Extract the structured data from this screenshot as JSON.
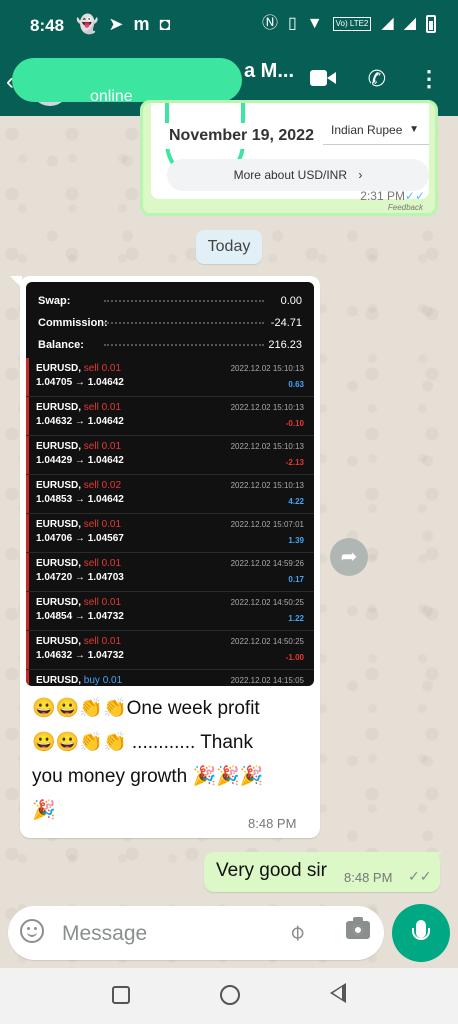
{
  "status_bar": {
    "time": "8:48",
    "left_icons": [
      "snapchat-icon",
      "telegram-icon",
      "m-icon",
      "instagram-icon"
    ],
    "right_icons": [
      "nfc-icon",
      "vibrate-icon",
      "wifi-icon",
      "volte-icon",
      "signal-icon",
      "signal-icon",
      "battery-icon"
    ],
    "m_label": "m",
    "volte_label": "Vo) LTE2"
  },
  "chat_header": {
    "name_suffix": "a M...",
    "status": "online",
    "colors": {
      "header": "#075e54",
      "redaction": "#3ce6a0"
    }
  },
  "link_card": {
    "date": "November 19, 2022",
    "currency": "Indian Rupee",
    "more_label": "More about USD/INR",
    "more_arrow": "›",
    "time": "2:31 PM",
    "ticks": "✓✓",
    "feedback": "Feedback"
  },
  "date_chip": "Today",
  "trade_screenshot": {
    "summary": [
      {
        "label": "Swap:",
        "value": "0.00"
      },
      {
        "label": "Commission:",
        "value": "-24.71"
      },
      {
        "label": "Balance:",
        "value": "216.23"
      }
    ],
    "trades": [
      {
        "symbol": "EURUSD,",
        "side": "sell 0.01",
        "prices": "1.04705 → 1.04642",
        "time": "2022.12.02 15:10:13",
        "profit": "0.63",
        "positive": true
      },
      {
        "symbol": "EURUSD,",
        "side": "sell 0.01",
        "prices": "1.04632 → 1.04642",
        "time": "2022.12.02 15:10:13",
        "profit": "-0.10",
        "positive": false
      },
      {
        "symbol": "EURUSD,",
        "side": "sell 0.01",
        "prices": "1.04429 → 1.04642",
        "time": "2022.12.02 15:10:13",
        "profit": "-2.13",
        "positive": false
      },
      {
        "symbol": "EURUSD,",
        "side": "sell 0.02",
        "prices": "1.04853 → 1.04642",
        "time": "2022.12.02 15:10:13",
        "profit": "4.22",
        "positive": true
      },
      {
        "symbol": "EURUSD,",
        "side": "sell 0.01",
        "prices": "1.04706 → 1.04567",
        "time": "2022.12.02 15:07:01",
        "profit": "1.39",
        "positive": true
      },
      {
        "symbol": "EURUSD,",
        "side": "sell 0.01",
        "prices": "1.04720 → 1.04703",
        "time": "2022.12.02 14:59:26",
        "profit": "0.17",
        "positive": true
      },
      {
        "symbol": "EURUSD,",
        "side": "sell 0.01",
        "prices": "1.04854 → 1.04732",
        "time": "2022.12.02 14:50:25",
        "profit": "1.22",
        "positive": true
      },
      {
        "symbol": "EURUSD,",
        "side": "sell 0.01",
        "prices": "1.04632 → 1.04732",
        "time": "2022.12.02 14:50:25",
        "profit": "-1.00",
        "positive": false
      },
      {
        "symbol": "EURUSD,",
        "side": "buy 0.01",
        "prices": "",
        "time": "2022.12.02 14:15:05",
        "profit": "",
        "positive": true
      }
    ],
    "colors": {
      "sell": "#e53935",
      "buy": "#42a5f5",
      "profit_positive": "#42a5f5",
      "profit_negative": "#e53935",
      "bar": "#c62828"
    }
  },
  "incoming_message": {
    "text_line1": "😀😀👏👏One week profit",
    "text_line2": "😀😀👏👏 ............ Thank",
    "text_line3": "you money growth 🎉🎉🎉",
    "text_line4": "🎉",
    "time": "8:48 PM"
  },
  "outgoing_message": {
    "text": "Very good sir",
    "time": "8:48 PM",
    "ticks": "✓✓"
  },
  "composer": {
    "placeholder": "Message"
  },
  "icons": {
    "back": "‹",
    "phone": "✆",
    "menu": "⋮",
    "forward": "➦",
    "attach": "📎"
  }
}
